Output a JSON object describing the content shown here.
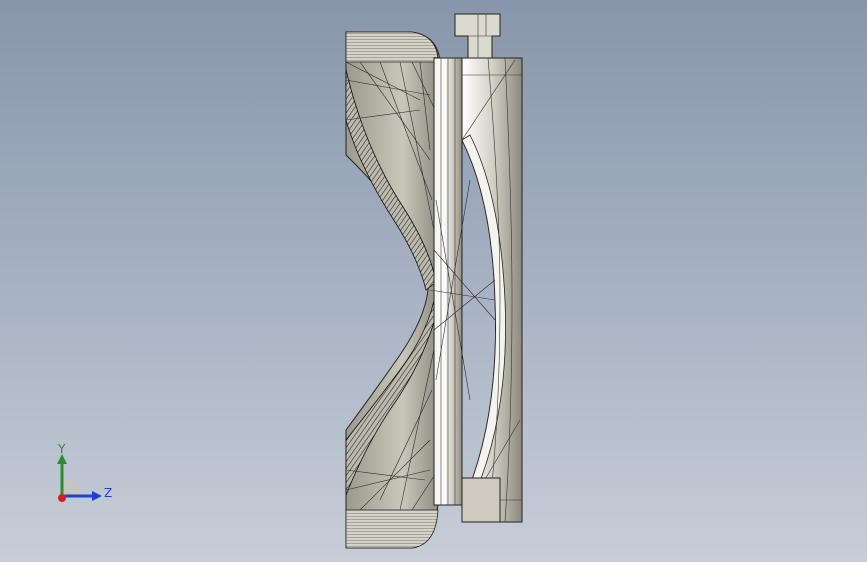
{
  "viewport": {
    "background_top": "#8896ab",
    "background_bottom": "#c7ced8"
  },
  "model": {
    "name": "mesh-part",
    "fill": "#b9b6a9",
    "highlight": "#e6e4dc",
    "shadow": "#6f6c62",
    "edge": "#1e1e1e"
  },
  "triad": {
    "y_label": "Y",
    "z_label": "Z",
    "y_color": "#2e8b2e",
    "z_color": "#1f3fd6",
    "x_color": "#d62020"
  }
}
